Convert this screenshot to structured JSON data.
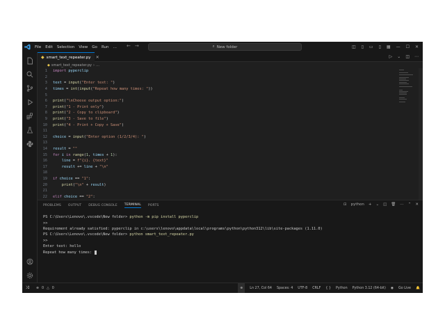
{
  "titlebar": {
    "menu": [
      "File",
      "Edit",
      "Selection",
      "View",
      "Go",
      "Run",
      "…"
    ],
    "search_text": "New folder"
  },
  "tab": {
    "filename": "smart_text_repeater.py"
  },
  "breadcrumb": {
    "file": "smart_text_repeater.py",
    "rest": "…"
  },
  "code_lines": [
    {
      "n": "1",
      "tokens": [
        [
          "kw",
          "import "
        ],
        [
          "va",
          "pyperclip"
        ]
      ]
    },
    {
      "n": "2",
      "tokens": []
    },
    {
      "n": "3",
      "tokens": [
        [
          "va",
          "text"
        ],
        [
          "op",
          " = "
        ],
        [
          "bi",
          "input"
        ],
        [
          "op",
          "("
        ],
        [
          "st",
          "\"Enter text: \""
        ],
        [
          "op",
          ")"
        ]
      ]
    },
    {
      "n": "4",
      "tokens": [
        [
          "va",
          "times"
        ],
        [
          "op",
          " = "
        ],
        [
          "bi",
          "int"
        ],
        [
          "op",
          "("
        ],
        [
          "bi",
          "input"
        ],
        [
          "op",
          "("
        ],
        [
          "st",
          "\"Repeat how many times: \""
        ],
        [
          "op",
          "))"
        ]
      ]
    },
    {
      "n": "5",
      "tokens": []
    },
    {
      "n": "6",
      "tokens": [
        [
          "bi",
          "print"
        ],
        [
          "op",
          "("
        ],
        [
          "st",
          "\"\\nChoose output option:\""
        ],
        [
          "op",
          ")"
        ]
      ]
    },
    {
      "n": "7",
      "tokens": [
        [
          "bi",
          "print"
        ],
        [
          "op",
          "("
        ],
        [
          "st",
          "\"1 - Print only\""
        ],
        [
          "op",
          ")"
        ]
      ]
    },
    {
      "n": "8",
      "tokens": [
        [
          "bi",
          "print"
        ],
        [
          "op",
          "("
        ],
        [
          "st",
          "\"2 - Copy to clipboard\""
        ],
        [
          "op",
          ")"
        ]
      ]
    },
    {
      "n": "9",
      "tokens": [
        [
          "bi",
          "print"
        ],
        [
          "op",
          "("
        ],
        [
          "st",
          "\"3 - Save to file\""
        ],
        [
          "op",
          ")"
        ]
      ]
    },
    {
      "n": "10",
      "tokens": [
        [
          "bi",
          "print"
        ],
        [
          "op",
          "("
        ],
        [
          "st",
          "\"4 - Print + Copy + Save\""
        ],
        [
          "op",
          ")"
        ]
      ]
    },
    {
      "n": "11",
      "tokens": []
    },
    {
      "n": "12",
      "tokens": [
        [
          "va",
          "choice"
        ],
        [
          "op",
          " = "
        ],
        [
          "bi",
          "input"
        ],
        [
          "op",
          "("
        ],
        [
          "st",
          "\"Enter option (1/2/3/4): \""
        ],
        [
          "op",
          ")"
        ]
      ]
    },
    {
      "n": "13",
      "tokens": []
    },
    {
      "n": "14",
      "tokens": [
        [
          "va",
          "result"
        ],
        [
          "op",
          " = "
        ],
        [
          "st",
          "\"\""
        ]
      ]
    },
    {
      "n": "15",
      "tokens": [
        [
          "kw",
          "for "
        ],
        [
          "va",
          "i"
        ],
        [
          "kw",
          " in "
        ],
        [
          "bi",
          "range"
        ],
        [
          "op",
          "("
        ],
        [
          "nm",
          "1"
        ],
        [
          "op",
          ", "
        ],
        [
          "va",
          "times"
        ],
        [
          "op",
          " + "
        ],
        [
          "nm",
          "1"
        ],
        [
          "op",
          "):"
        ]
      ]
    },
    {
      "n": "16",
      "tokens": [
        [
          "op",
          "    "
        ],
        [
          "va",
          "line"
        ],
        [
          "op",
          " = "
        ],
        [
          "st",
          "f\"{i}. {text}\""
        ]
      ]
    },
    {
      "n": "17",
      "tokens": [
        [
          "op",
          "    "
        ],
        [
          "va",
          "result"
        ],
        [
          "op",
          " += "
        ],
        [
          "va",
          "line"
        ],
        [
          "op",
          " + "
        ],
        [
          "st",
          "\"\\n\""
        ]
      ]
    },
    {
      "n": "18",
      "tokens": []
    },
    {
      "n": "19",
      "tokens": [
        [
          "kw",
          "if "
        ],
        [
          "va",
          "choice"
        ],
        [
          "op",
          " == "
        ],
        [
          "st",
          "\"1\""
        ],
        [
          "op",
          ":"
        ]
      ]
    },
    {
      "n": "20",
      "tokens": [
        [
          "op",
          "    "
        ],
        [
          "bi",
          "print"
        ],
        [
          "op",
          "("
        ],
        [
          "st",
          "\"\\n\""
        ],
        [
          "op",
          " + "
        ],
        [
          "va",
          "result"
        ],
        [
          "op",
          ")"
        ]
      ]
    },
    {
      "n": "21",
      "tokens": []
    },
    {
      "n": "22",
      "tokens": [
        [
          "kw",
          "elif "
        ],
        [
          "va",
          "choice"
        ],
        [
          "op",
          " == "
        ],
        [
          "st",
          "\"2\""
        ],
        [
          "op",
          ":"
        ]
      ]
    }
  ],
  "panel": {
    "tabs": [
      "PROBLEMS",
      "OUTPUT",
      "DEBUG CONSOLE",
      "TERMINAL",
      "PORTS"
    ],
    "active_tab": "TERMINAL",
    "shell_name": "python"
  },
  "terminal_lines": [
    {
      "prompt": "PS C:\\Users\\Lenovo\\.vscode\\New folder> ",
      "cmd": "python -m pip install pyperclip"
    },
    {
      "prompt": ">>",
      "cmd": ""
    },
    {
      "prompt": "Requirement already satisfied: pyperclip in c:\\users\\lenovo\\appdata\\local\\programs\\python\\python312\\lib\\site-packages (1.11.0)",
      "cmd": ""
    },
    {
      "prompt": "PS C:\\Users\\Lenovo\\.vscode\\New folder> ",
      "cmd": "python smart_text_repeater.py"
    },
    {
      "prompt": ">>",
      "cmd": ""
    },
    {
      "prompt": "Enter text: hello",
      "cmd": ""
    },
    {
      "prompt": "Repeat how many times: ",
      "cmd": ""
    }
  ],
  "statusbar": {
    "errors": "0",
    "warnings": "0",
    "position": "Ln 27, Col 64",
    "spaces": "Spaces: 4",
    "encoding": "UTF-8",
    "eol": "CRLF",
    "language": "Python",
    "interpreter": "Python 3.12 (64-bit)",
    "golive": "Go Live"
  }
}
